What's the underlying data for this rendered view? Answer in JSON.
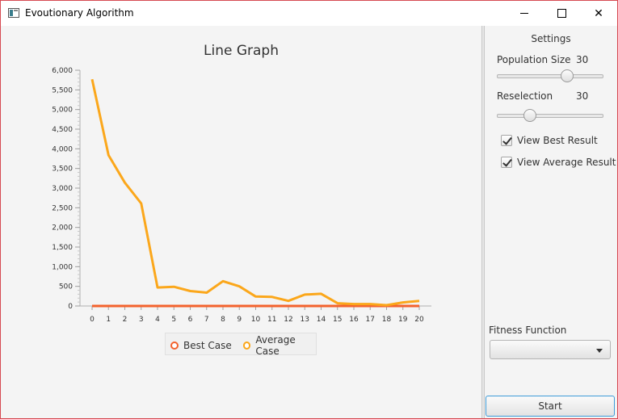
{
  "window": {
    "title": "Evoutionary Algorithm",
    "controls": {
      "minimize": "minimize-icon",
      "maximize": "maximize-icon",
      "close": "close-icon"
    }
  },
  "chart_data": {
    "type": "line",
    "title": "Line Graph",
    "xlabel": "",
    "ylabel": "",
    "x": [
      0,
      1,
      2,
      3,
      4,
      5,
      6,
      7,
      8,
      9,
      10,
      11,
      12,
      13,
      14,
      15,
      16,
      17,
      18,
      19,
      20
    ],
    "ylim": [
      0,
      6000
    ],
    "yticks": [
      "0",
      "500",
      "1,000",
      "1,500",
      "2,000",
      "2,500",
      "3,000",
      "3,500",
      "4,000",
      "4,500",
      "5,000",
      "5,500",
      "6,000"
    ],
    "series": [
      {
        "name": "Best Case",
        "color": "#f3622d",
        "values": [
          0,
          0,
          0,
          0,
          0,
          0,
          0,
          0,
          0,
          0,
          0,
          0,
          0,
          0,
          0,
          0,
          0,
          0,
          0,
          0,
          0
        ]
      },
      {
        "name": "Average Case",
        "color": "#fba71b",
        "values": [
          5770,
          3840,
          3140,
          2610,
          470,
          490,
          380,
          340,
          630,
          500,
          240,
          230,
          130,
          290,
          310,
          70,
          50,
          50,
          20,
          90,
          130
        ]
      }
    ],
    "grid": false,
    "legend": "bottom"
  },
  "sidebar": {
    "title": "Settings",
    "population": {
      "label": "Population Size",
      "value": "30",
      "fraction": 0.66
    },
    "reselection": {
      "label": "Reselection",
      "value": "30",
      "fraction": 0.31
    },
    "view_best": {
      "label": "View Best Result",
      "checked": true
    },
    "view_average": {
      "label": "View Average Result",
      "checked": true
    },
    "fitness_label": "Fitness Function",
    "fitness_value": "",
    "start_label": "Start"
  }
}
